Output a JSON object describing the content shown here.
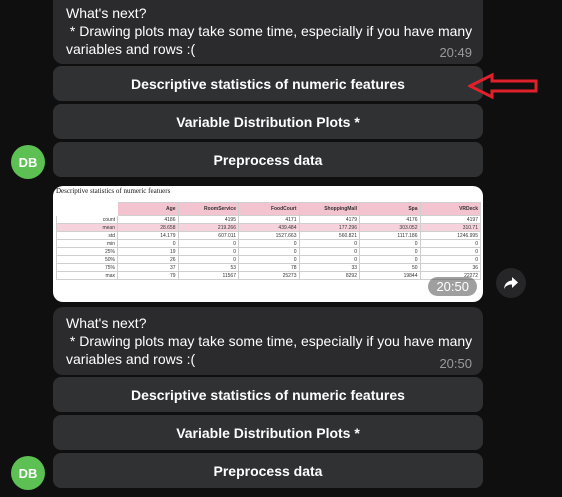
{
  "messages": [
    {
      "text": "What's next?\n * Drawing plots may take some time, especially if you have many variables and rows :(",
      "time": "20:49"
    },
    {
      "text": "What's next?\n * Drawing plots may take some time, especially if you have many variables and rows :(",
      "time": "20:50"
    }
  ],
  "keyboard1": [
    "Descriptive statistics of numeric features",
    "Variable Distribution Plots *",
    "Preprocess data"
  ],
  "keyboard2": [
    "Descriptive statistics of numeric features",
    "Variable Distribution Plots *",
    "Preprocess data"
  ],
  "avatar": {
    "initials": "DB",
    "color": "#5cc052"
  },
  "image": {
    "title": "Descriptive statistics of numeric featuers",
    "time": "20:50",
    "columns": [
      "Age",
      "RoomService",
      "FoodCourt",
      "ShoppingMall",
      "Spa",
      "VRDeck"
    ],
    "rows": [
      {
        "label": "count",
        "values": [
          "4186",
          "4195",
          "4171",
          "4179",
          "4176",
          "4197"
        ]
      },
      {
        "label": "mean",
        "values": [
          "28.658",
          "219.266",
          "439.484",
          "177.296",
          "303.052",
          "310.71"
        ]
      },
      {
        "label": "std",
        "values": [
          "14.179",
          "607.011",
          "1527.663",
          "560.821",
          "1117.186",
          "1246.995"
        ]
      },
      {
        "label": "min",
        "values": [
          "0",
          "0",
          "0",
          "0",
          "0",
          "0"
        ]
      },
      {
        "label": "25%",
        "values": [
          "19",
          "0",
          "0",
          "0",
          "0",
          "0"
        ]
      },
      {
        "label": "50%",
        "values": [
          "26",
          "0",
          "0",
          "0",
          "0",
          "0"
        ]
      },
      {
        "label": "75%",
        "values": [
          "37",
          "53",
          "78",
          "33",
          "50",
          "36"
        ]
      },
      {
        "label": "max",
        "values": [
          "79",
          "11567",
          "25273",
          "8292",
          "19844",
          "22272"
        ]
      }
    ]
  },
  "colors": {
    "background": "#0f0f0f",
    "bubble": "#2b2b2d",
    "button": "#303133",
    "accent_red": "#e0202a",
    "table_header": "#f3c4cf"
  },
  "icons": {
    "share": "share-arrow-icon",
    "annotation": "red-arrow-icon"
  }
}
